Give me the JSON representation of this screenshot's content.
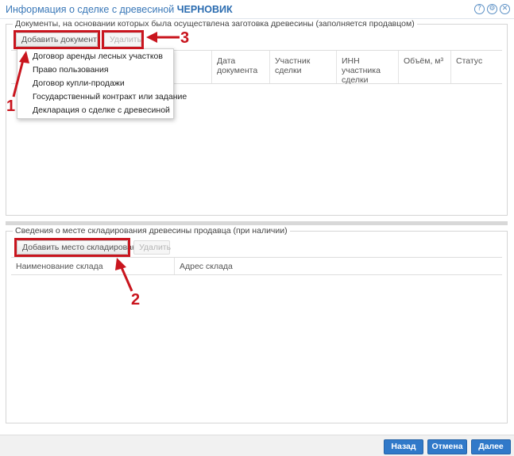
{
  "window": {
    "title_prefix": "Информация о сделке с древесиной ",
    "title_status": "ЧЕРНОВИК",
    "icons": [
      "help-icon",
      "settings-icon",
      "close-icon"
    ],
    "icon_glyphs": {
      "help": "?",
      "settings": "⚙",
      "close": "✕"
    }
  },
  "documents": {
    "legend": "Документы, на основании которых была осуществлена заготовка древесины (заполняется продавцом)",
    "add_button": "Добавить документ",
    "delete_button": "Удалить",
    "columns": [
      "Дата документа",
      "Участник сделки",
      "ИНН участника сделки",
      "Объём, м³",
      "Статус"
    ],
    "dropdown_items": [
      "Договор аренды лесных участков",
      "Право пользования",
      "Договор купли-продажи",
      "Государственный контракт или задание",
      "Декларация о сделке с древесиной"
    ]
  },
  "storage": {
    "legend": "Сведения о месте складирования древесины продавца (при наличии)",
    "add_button": "Добавить место складирования",
    "delete_button": "Удалить",
    "columns": [
      "Наименование склада",
      "Адрес склада"
    ]
  },
  "annotations": {
    "label_1": "1",
    "label_2": "2",
    "label_3": "3",
    "color": "#c9151e"
  },
  "footer": {
    "back": "Назад",
    "cancel": "Отмена",
    "next": "Далее",
    "accent": "#3079c9"
  }
}
